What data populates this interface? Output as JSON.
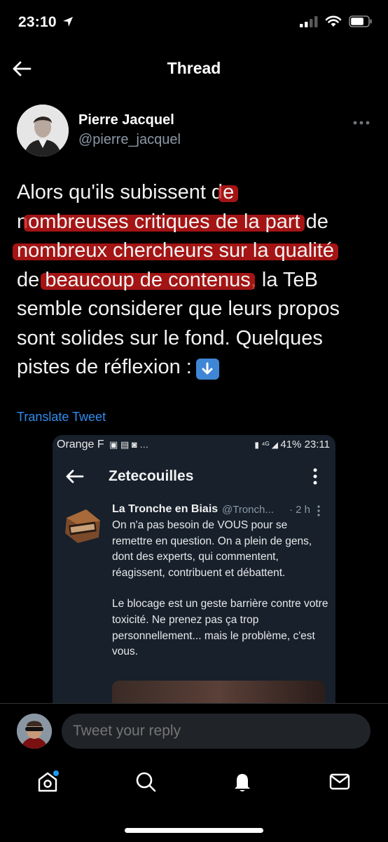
{
  "status_bar": {
    "time": "23:10",
    "battery_level": 0.75
  },
  "header": {
    "title": "Thread"
  },
  "author": {
    "name": "Pierre Jacquel",
    "handle": "@pierre_jacquel"
  },
  "tweet": {
    "lines": [
      {
        "pre": "Alors qu'ils subissent d",
        "hl": "e",
        "post": ""
      },
      {
        "pre": "n",
        "hl": "ombreuses critiques de la part",
        "post": " de"
      },
      {
        "pre": "",
        "hl": "nombreux chercheurs sur la qualité",
        "post": ""
      },
      {
        "pre": "de ",
        "hl": "beaucoup de contenus",
        "post": ", la TeB"
      },
      {
        "pre": "semble considerer que leurs propos",
        "hl": "",
        "post": ""
      },
      {
        "pre": "sont solides sur le fond. Quelques",
        "hl": "",
        "post": ""
      },
      {
        "pre": "pistes de réflexion :",
        "hl": "",
        "post": ""
      }
    ],
    "emoji": "down-arrow-emoji",
    "highlight_color": "#cd1919",
    "translate_label": "Translate Tweet"
  },
  "embed": {
    "status_carrier": "Orange F",
    "status_right": "41% 23:11",
    "title": "Zetecouilles",
    "tweet_name": "La Tronche en Biais",
    "tweet_handle": "@Tronch...",
    "tweet_time": "· 2 h",
    "tweet_paragraphs": [
      "On n'a pas besoin de VOUS pour se remettre en question. On a plein de gens, dont des experts, qui commentent, réagissent, contribuent et débattent.",
      "Le blocage est un geste barrière contre votre toxicité. Ne prenez pas ça trop personnellement... mais le problème, c'est vous."
    ]
  },
  "reply": {
    "placeholder": "Tweet your reply"
  },
  "tabbar": {
    "items": [
      "home-icon",
      "search-icon",
      "notifications-icon",
      "messages-icon"
    ],
    "home_has_dot": true
  },
  "colors": {
    "accent": "#1d9bf0",
    "link": "#2f8ef0",
    "background": "#000000"
  }
}
